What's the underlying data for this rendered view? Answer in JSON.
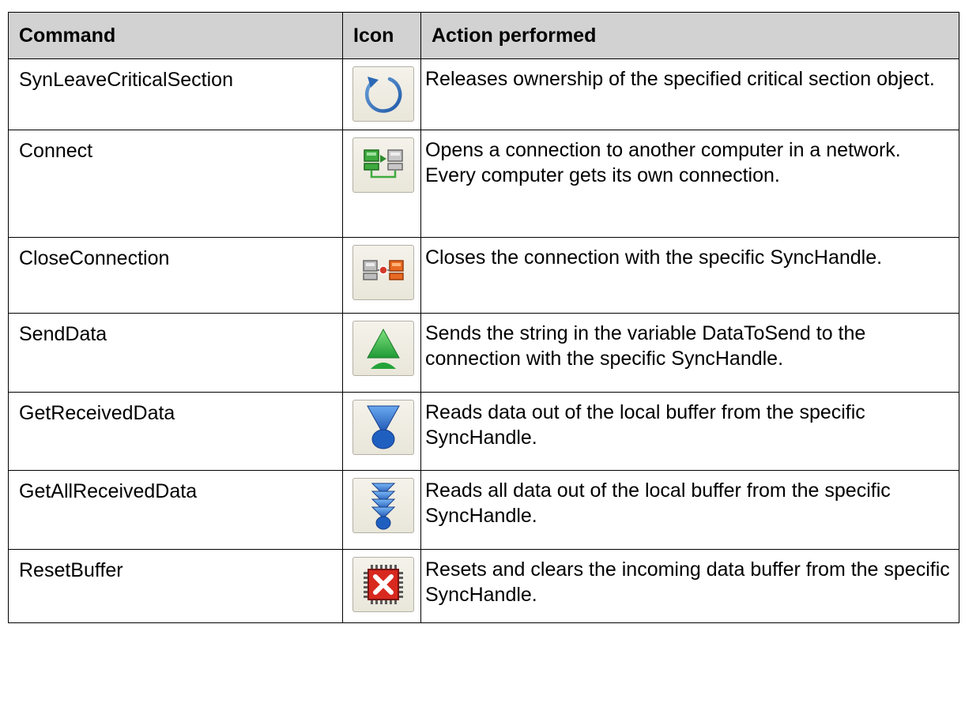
{
  "table": {
    "headers": {
      "command": "Command",
      "icon": "Icon",
      "action": "Action performed"
    },
    "rows": [
      {
        "command": "SynLeaveCriticalSection",
        "icon": "circular-arrow-icon",
        "action": "Releases ownership of the specified critical section object."
      },
      {
        "command": "Connect",
        "icon": "connect-computers-icon",
        "action": "Opens a connection to another computer in a network. Every computer gets its own connection."
      },
      {
        "command": "CloseConnection",
        "icon": "close-connection-icon",
        "action": "Closes the connection with the specific SyncHandle."
      },
      {
        "command": "SendData",
        "icon": "send-arrow-up-icon",
        "action": "Sends the string in the variable DataToSend to the connection with the specific SyncHandle."
      },
      {
        "command": "GetReceivedData",
        "icon": "receive-funnel-icon",
        "action": "Reads data out of the local buffer from the specific SyncHandle."
      },
      {
        "command": "GetAllReceivedData",
        "icon": "receive-all-arrows-icon",
        "action": "Reads all data out of the local buffer from the specific SyncHandle."
      },
      {
        "command": "ResetBuffer",
        "icon": "reset-buffer-chip-icon",
        "action": "Resets and clears the incoming data buffer from the specific SyncHandle."
      }
    ]
  }
}
